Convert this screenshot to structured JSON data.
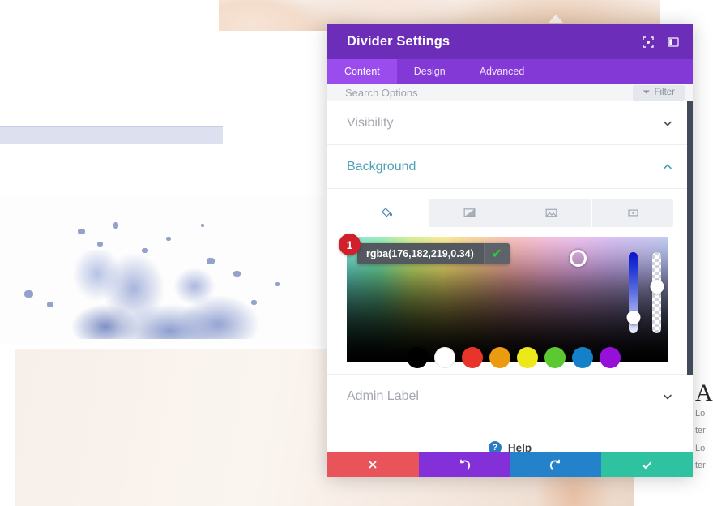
{
  "page": {
    "right_column": {
      "heading": "A",
      "lines": [
        "Lo",
        "ter",
        "Lo",
        "ter"
      ]
    }
  },
  "modal": {
    "title": "Divider Settings",
    "header_icons": [
      {
        "name": "focus-icon",
        "label": "Focus"
      },
      {
        "name": "panel-layout-icon",
        "label": "Layout"
      }
    ],
    "tabs": [
      {
        "label": "Content",
        "active": true
      },
      {
        "label": "Design",
        "active": false
      },
      {
        "label": "Advanced",
        "active": false
      }
    ],
    "search": {
      "placeholder": "Search Options",
      "filter_label": "Filter"
    },
    "sections": [
      {
        "label": "Visibility",
        "open": false
      },
      {
        "label": "Background",
        "open": true
      },
      {
        "label": "Admin Label",
        "open": false
      }
    ],
    "background": {
      "type_tabs": [
        {
          "name": "background-color-tab",
          "label": "Background Color",
          "active": true
        },
        {
          "name": "background-gradient-tab",
          "label": "Background Gradient",
          "active": false
        },
        {
          "name": "background-image-tab",
          "label": "Background Image",
          "active": false
        },
        {
          "name": "background-video-tab",
          "label": "Background Video",
          "active": false
        }
      ],
      "color_value": "rgba(176,182,219,0.34)",
      "step_badge": "1",
      "confirm_glyph": "✔",
      "swatches": [
        {
          "name": "swatch-black",
          "color": "#000000"
        },
        {
          "name": "swatch-white",
          "color": "#ffffff"
        },
        {
          "name": "swatch-red",
          "color": "#e8342a"
        },
        {
          "name": "swatch-orange",
          "color": "#eb9b10"
        },
        {
          "name": "swatch-yellow",
          "color": "#ece81c"
        },
        {
          "name": "swatch-green",
          "color": "#5cc932"
        },
        {
          "name": "swatch-blue",
          "color": "#1480c8"
        },
        {
          "name": "swatch-purple",
          "color": "#9610d8"
        }
      ],
      "hue_slider_value": 72,
      "alpha_slider_value": 34
    },
    "help": {
      "label": "Help",
      "glyph": "?"
    },
    "footer_buttons": [
      {
        "name": "cancel-button",
        "label": "Cancel",
        "color": "#e8545a",
        "glyph": "close"
      },
      {
        "name": "undo-button",
        "label": "Undo",
        "color": "#8430d8",
        "glyph": "undo"
      },
      {
        "name": "redo-button",
        "label": "Redo",
        "color": "#2482cb",
        "glyph": "redo"
      },
      {
        "name": "save-button",
        "label": "Save",
        "color": "#2ec2a0",
        "glyph": "check"
      }
    ]
  },
  "colors": {
    "header_purple": "#6c2eb9",
    "tabbar_purple": "#8239d6",
    "active_tab_purple": "#9a4ced",
    "accent_teal": "#4f9fb8",
    "badge_red": "#d0202c"
  }
}
